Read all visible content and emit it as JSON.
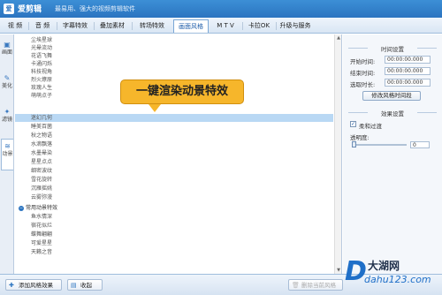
{
  "app": {
    "icon_text": "爱",
    "name": "爱剪辑",
    "slogan": "最易用、强大的视频剪辑软件"
  },
  "tabs": [
    {
      "label": "视  频"
    },
    {
      "label": "音  频"
    },
    {
      "label": "字幕特效"
    },
    {
      "label": "叠加素材"
    },
    {
      "label": "转场特效"
    },
    {
      "label": "画面风格",
      "active": true
    },
    {
      "label": "M T V"
    },
    {
      "label": "卡拉OK"
    },
    {
      "label": "升级与服务"
    }
  ],
  "side_tabs": [
    {
      "label": "画面",
      "icon": "image-icon"
    },
    {
      "label": "美化",
      "icon": "brush-icon"
    },
    {
      "label": "滤镜",
      "icon": "filter-icon"
    },
    {
      "label": "动景",
      "icon": "motion-icon",
      "active": true
    }
  ],
  "list": {
    "items_top": [
      "尘埃星球",
      "光晕流动",
      "花语飞舞",
      "卡通闪烁",
      "科技视角",
      "烈火燎原",
      "玫瑰人生",
      "萌萌点子"
    ],
    "selected": "迷幻几何",
    "items_mid": [
      "睡美百菌",
      "秋之物语",
      "水滴飘落",
      "水墨晕染",
      "星星点点",
      "细密波纹",
      "雪花旋转",
      "沉雁摇姚",
      "云雾弥漫"
    ],
    "category": "常用动景特效",
    "items_bottom": [
      "鱼水情深",
      "宿花似烂",
      "蝶舞翩翩",
      "可爱星星",
      "天籁之音"
    ]
  },
  "callout": {
    "text": "一键渲染动景特效"
  },
  "right_panel": {
    "time_section_title": "时间设置",
    "start_label": "开始时间:",
    "start_value": "00:00:00.000",
    "end_label": "结束时间:",
    "end_value": "00:00:00.000",
    "duration_label": "选取时长:",
    "duration_value": "00:00:00.000",
    "modify_button": "修改风格时间段",
    "effect_section_title": "效果设置",
    "soft_transition_label": "柔和过渡",
    "soft_transition_checked": true,
    "opacity_label": "透明度:",
    "opacity_value": "0",
    "opacity_level": 0
  },
  "bottom": {
    "add_button": "添加风格效果",
    "favorite_button": "收起",
    "delete_button": "删除当前风格"
  },
  "watermark": {
    "letter": "D",
    "name": "大湖网",
    "url": "dahu123.com"
  },
  "colors": {
    "titlebar": "#2b74c0",
    "callout": "#f6b62b",
    "selected_row": "#b9d8f4"
  }
}
